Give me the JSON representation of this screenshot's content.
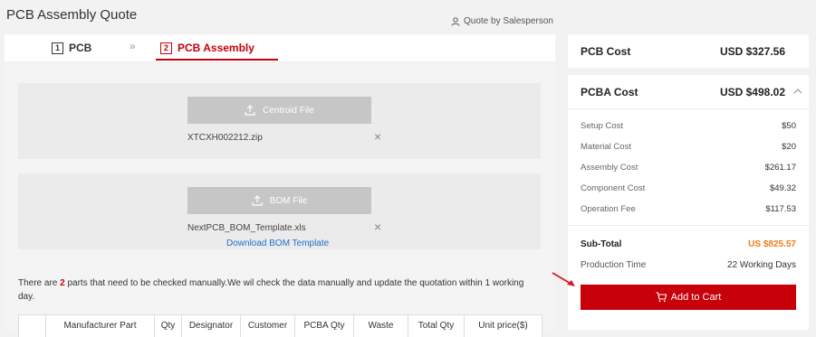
{
  "header": {
    "title": "PCB Assembly Quote",
    "salesperson_label": "Quote by Salesperson"
  },
  "steps": [
    {
      "number": "1",
      "label": "PCB"
    },
    {
      "number": "2",
      "label": "PCB Assembly"
    }
  ],
  "step_separator": "»",
  "uploads": {
    "centroid": {
      "button_label": "Centroid File",
      "file_name": "XTCXH002212.zip"
    },
    "bom": {
      "button_label": "BOM File",
      "file_name": "NextPCB_BOM_Template.xls",
      "template_link": "Download BOM Template"
    }
  },
  "remove_symbol": "×",
  "notice": {
    "prefix": "There are ",
    "count": "2",
    "suffix": " parts that need to be checked manually.We wil check the data manually and update the quotation within 1 working day."
  },
  "table": {
    "headers": [
      "",
      "Manufacturer Part",
      "Qty",
      "Designator",
      "Customer",
      "PCBA Qty",
      "Waste",
      "Total Qty",
      "Unit price($)"
    ]
  },
  "pcb_cost": {
    "label": "PCB Cost",
    "value": "USD $327.56"
  },
  "pcba_cost": {
    "label": "PCBA Cost",
    "value": "USD $498.02",
    "items": [
      {
        "label": "Setup Cost",
        "value": "$50"
      },
      {
        "label": "Material Cost",
        "value": "$20"
      },
      {
        "label": "Assembly Cost",
        "value": "$261.17"
      },
      {
        "label": "Component Cost",
        "value": "$49.32"
      },
      {
        "label": "Operation Fee",
        "value": "$117.53"
      }
    ],
    "subtotal_label": "Sub-Total",
    "subtotal_value": "US $825.57",
    "production_label": "Production Time",
    "production_value": "22 Working Days",
    "add_to_cart": "Add to Cart"
  },
  "colors": {
    "accent": "#c8000a",
    "subtotal": "#f07c1a",
    "link": "#1f6fd0"
  },
  "icons": [
    "person-icon",
    "upload-icon",
    "close-icon",
    "chevron-up-icon",
    "cart-icon",
    "arrow-icon"
  ]
}
